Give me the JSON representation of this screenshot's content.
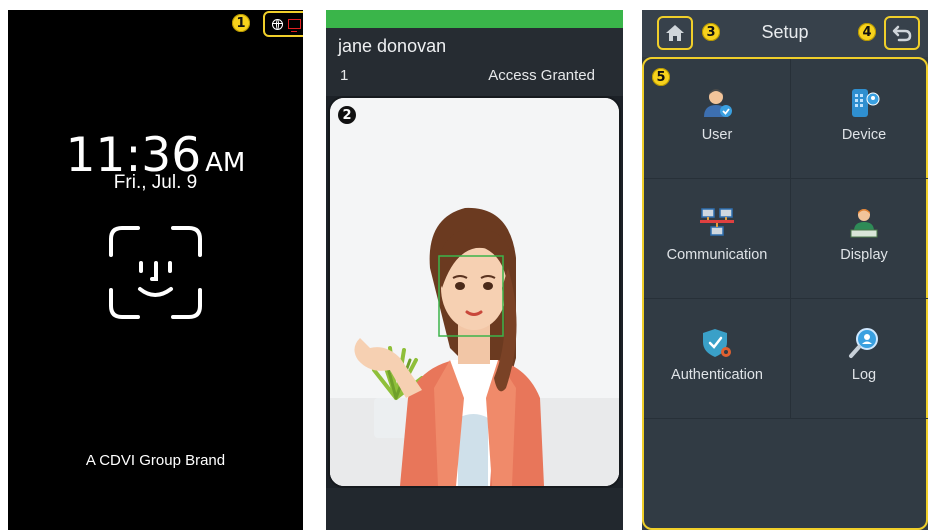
{
  "idle": {
    "time": "11:36",
    "ampm": "AM",
    "date": "Fri., Jul. 9",
    "brand": "A CDVI Group Brand",
    "badge": "1"
  },
  "access": {
    "user_name": "jane donovan",
    "user_id": "1",
    "status": "Access Granted",
    "badge": "2",
    "status_color": "#3ab54a"
  },
  "setup": {
    "title": "Setup",
    "badge_home": "3",
    "badge_back": "4",
    "badge_grid": "5",
    "items": [
      {
        "label": "User",
        "icon": "user-icon"
      },
      {
        "label": "Device",
        "icon": "device-icon"
      },
      {
        "label": "Communication",
        "icon": "communication-icon"
      },
      {
        "label": "Display",
        "icon": "display-icon"
      },
      {
        "label": "Authentication",
        "icon": "authentication-icon"
      },
      {
        "label": "Log",
        "icon": "log-icon"
      }
    ],
    "highlight_color": "#f0cf2a"
  }
}
